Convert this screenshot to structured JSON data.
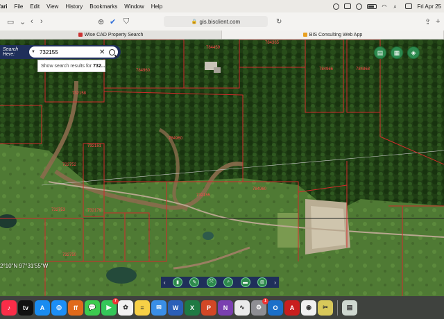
{
  "menubar": {
    "app": "fari",
    "items": [
      "File",
      "Edit",
      "View",
      "History",
      "Bookmarks",
      "Window",
      "Help"
    ],
    "clock": "Fri Apr 25"
  },
  "toolbar": {
    "url": "gis.bisclient.com"
  },
  "tabs": [
    {
      "label": "Wise CAD Property Search"
    },
    {
      "label": "BIS Consulting Web App"
    }
  ],
  "search": {
    "label": "Search Here:",
    "value": "732155",
    "suggestion_prefix": "Show search results for",
    "suggestion_term": "732..."
  },
  "map": {
    "coordinates": "2°10\"N 97°31'55\"W",
    "parcel_labels": [
      "784459",
      "784365",
      "784960",
      "784966",
      "784868",
      "732158",
      "732155",
      "784960",
      "732151",
      "732752",
      "732179",
      "732753",
      "732750",
      "784960"
    ],
    "fab_icons": [
      "printer-icon",
      "grid-icon",
      "layers-icon"
    ],
    "tools": [
      "bookmark-icon",
      "pencil-icon",
      "measure-icon",
      "search-zoom-icon",
      "ruler-icon",
      "export-icon"
    ]
  },
  "dock": {
    "apps": [
      {
        "name": "music",
        "color": "#fa2d48",
        "glyph": "♪"
      },
      {
        "name": "apple-tv",
        "color": "#111111",
        "glyph": "tv"
      },
      {
        "name": "app-store",
        "color": "#1a8cf0",
        "glyph": "A"
      },
      {
        "name": "safari",
        "color": "#1c8ef5",
        "glyph": "◎"
      },
      {
        "name": "firefox",
        "color": "#e06a1b",
        "glyph": "ff"
      },
      {
        "name": "messages",
        "color": "#3ccb4f",
        "glyph": "💬"
      },
      {
        "name": "facetime",
        "color": "#34c759",
        "glyph": "▶",
        "badge": "7"
      },
      {
        "name": "photos",
        "color": "#f2f2f2",
        "glyph": "✿"
      },
      {
        "name": "notes",
        "color": "#f7d046",
        "glyph": "≡"
      },
      {
        "name": "mail",
        "color": "#3a8ee6",
        "glyph": "✉"
      },
      {
        "name": "word",
        "color": "#2b5fb8",
        "glyph": "W"
      },
      {
        "name": "excel",
        "color": "#1f7a43",
        "glyph": "X"
      },
      {
        "name": "powerpoint",
        "color": "#d24726",
        "glyph": "P"
      },
      {
        "name": "onenote",
        "color": "#7a3fb0",
        "glyph": "N"
      },
      {
        "name": "activity-monitor",
        "color": "#eaeaea",
        "glyph": "∿"
      },
      {
        "name": "system-settings",
        "color": "#8e8e93",
        "glyph": "⚙",
        "badge": "1"
      },
      {
        "name": "outlook",
        "color": "#1b6fc9",
        "glyph": "O"
      },
      {
        "name": "acrobat",
        "color": "#c81e1e",
        "glyph": "A"
      },
      {
        "name": "chrome",
        "color": "#f0f0f0",
        "glyph": "◉"
      },
      {
        "name": "tools",
        "color": "#d8c85a",
        "glyph": "✂"
      },
      {
        "name": "trash-preview",
        "color": "#cfd8d0",
        "glyph": "▤"
      }
    ]
  }
}
